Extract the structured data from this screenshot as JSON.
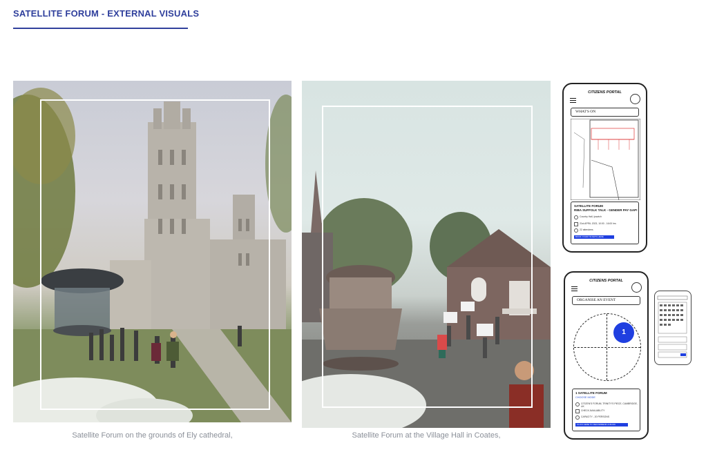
{
  "header": {
    "title": "SATELLITE FORUM - EXTERNAL VISUALS"
  },
  "visuals": [
    {
      "caption": "Satellite Forum on the grounds of Ely cathedral,"
    },
    {
      "caption": "Satellite Forum at the Village Hall in Coates,"
    }
  ],
  "phone_top": {
    "app_title": "CITIZENS PORTAL",
    "section": "WHAT'S ON",
    "card": {
      "title": "SATELLITE FORUM",
      "subtitle": "RIBA SUFFOLK TALK - GENDER PAY GAP!",
      "rows": [
        "Country Hall, Ipswich",
        "21st APRIL 2023, 10:00 - 16:00 hrs",
        "22 attendees"
      ],
      "cta": "BOOK YOUR TICKETS HERE"
    }
  },
  "phone_bottom": {
    "app_title": "CITIZENS PORTAL",
    "section": "ORGANISE AN EVENT",
    "dial_value": "1",
    "card": {
      "title": "1 SATELLITE FORUM",
      "subtitle": "CHOOSE MODE",
      "rows": [
        "CITIZEN'S FORUM, TRINITY'S PIECE, CAMBRIDGE, UK",
        "CHECK AVAILABILITY",
        "CAPACITY - 20 PERSONS"
      ],
      "cta": "CLICK HERE TO RECOMMEND & BOOK"
    }
  },
  "colors": {
    "accent": "#2f3f9c",
    "cta_blue": "#1f3fe0"
  }
}
